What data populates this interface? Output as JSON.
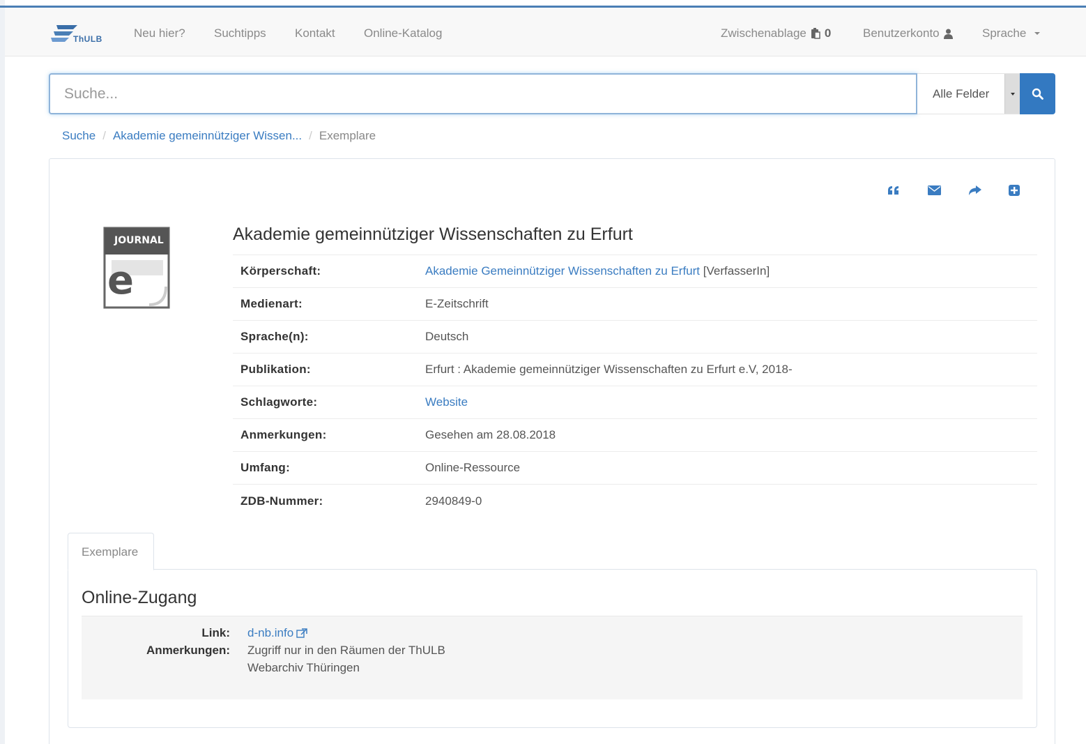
{
  "nav": {
    "logo_text": "ThULB",
    "links": [
      "Neu hier?",
      "Suchtipps",
      "Kontakt",
      "Online-Katalog"
    ],
    "clipboard_label": "Zwischenablage",
    "clipboard_count": "0",
    "account_label": "Benutzerkonto",
    "language_label": "Sprache"
  },
  "search": {
    "placeholder": "Suche...",
    "field_selected": "Alle Felder"
  },
  "breadcrumb": {
    "items": [
      "Suche",
      "Akademie gemeinnütziger Wissen..."
    ],
    "current": "Exemplare",
    "separator": "/"
  },
  "toolbar": {
    "icons": [
      "quote-icon",
      "email-icon",
      "export-icon",
      "add-to-list-icon"
    ]
  },
  "cover": {
    "label": "JOURNAL",
    "letter": "e"
  },
  "record": {
    "title": "Akademie gemeinnütziger Wissenschaften zu Erfurt",
    "fields": [
      {
        "label": "Körperschaft:",
        "value": "Akademie Gemeinnütziger Wissenschaften zu Erfurt",
        "suffix": " [VerfasserIn]",
        "link": true
      },
      {
        "label": "Medienart:",
        "value": "E-Zeitschrift",
        "suffix": "",
        "link": false
      },
      {
        "label": "Sprache(n):",
        "value": "Deutsch",
        "suffix": "",
        "link": false
      },
      {
        "label": "Publikation:",
        "value": "Erfurt : Akademie gemeinnütziger Wissenschaften zu Erfurt e.V, 2018-",
        "suffix": "",
        "link": false
      },
      {
        "label": "Schlagworte:",
        "value": "Website",
        "suffix": "",
        "link": true
      },
      {
        "label": "Anmerkungen:",
        "value": "Gesehen am 28.08.2018",
        "suffix": "",
        "link": false
      },
      {
        "label": "Umfang:",
        "value": "Online-Ressource",
        "suffix": "",
        "link": false
      },
      {
        "label": "ZDB-Nummer:",
        "value": "2940849-0",
        "suffix": "",
        "link": false
      }
    ]
  },
  "tabs": {
    "active": "Exemplare"
  },
  "online_access": {
    "title": "Online-Zugang",
    "link_label": "Link:",
    "link_text": "d-nb.info",
    "notes_label": "Anmerkungen:",
    "notes_line1": "Zugriff nur in den Räumen der ThULB",
    "notes_line2": "Webarchiv Thüringen"
  },
  "colors": {
    "accent": "#3379c1",
    "link": "#3a7cc1",
    "top_border": "#4a7fb5"
  }
}
